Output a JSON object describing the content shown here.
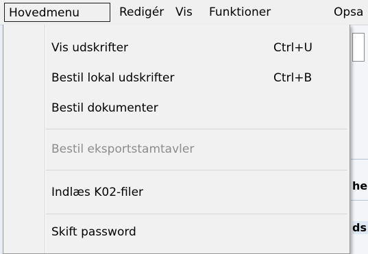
{
  "menubar": {
    "items": [
      {
        "label": "Hovedmenu"
      },
      {
        "label": "Redigér"
      },
      {
        "label": "Vis"
      },
      {
        "label": "Funktioner"
      },
      {
        "label": "Opsa"
      }
    ]
  },
  "dropdown": {
    "items": [
      {
        "label": "Vis udskrifter",
        "shortcut": "Ctrl+U",
        "enabled": true
      },
      {
        "label": "Bestil lokal udskrifter",
        "shortcut": "Ctrl+B",
        "enabled": true
      },
      {
        "label": "Bestil dokumenter",
        "shortcut": "",
        "enabled": true
      },
      {
        "label": "Bestil eksportstamtavler",
        "shortcut": "",
        "enabled": false
      },
      {
        "label": "Indlæs K02-filer",
        "shortcut": "",
        "enabled": true
      },
      {
        "label": "Skift password",
        "shortcut": "",
        "enabled": true
      }
    ]
  },
  "background": {
    "fragment_1": "he",
    "fragment_2": "ds"
  },
  "colors": {
    "menu_bg": "#f1f1f1",
    "disabled_text": "#8c8c8c",
    "window_bg": "#e9eef4"
  }
}
